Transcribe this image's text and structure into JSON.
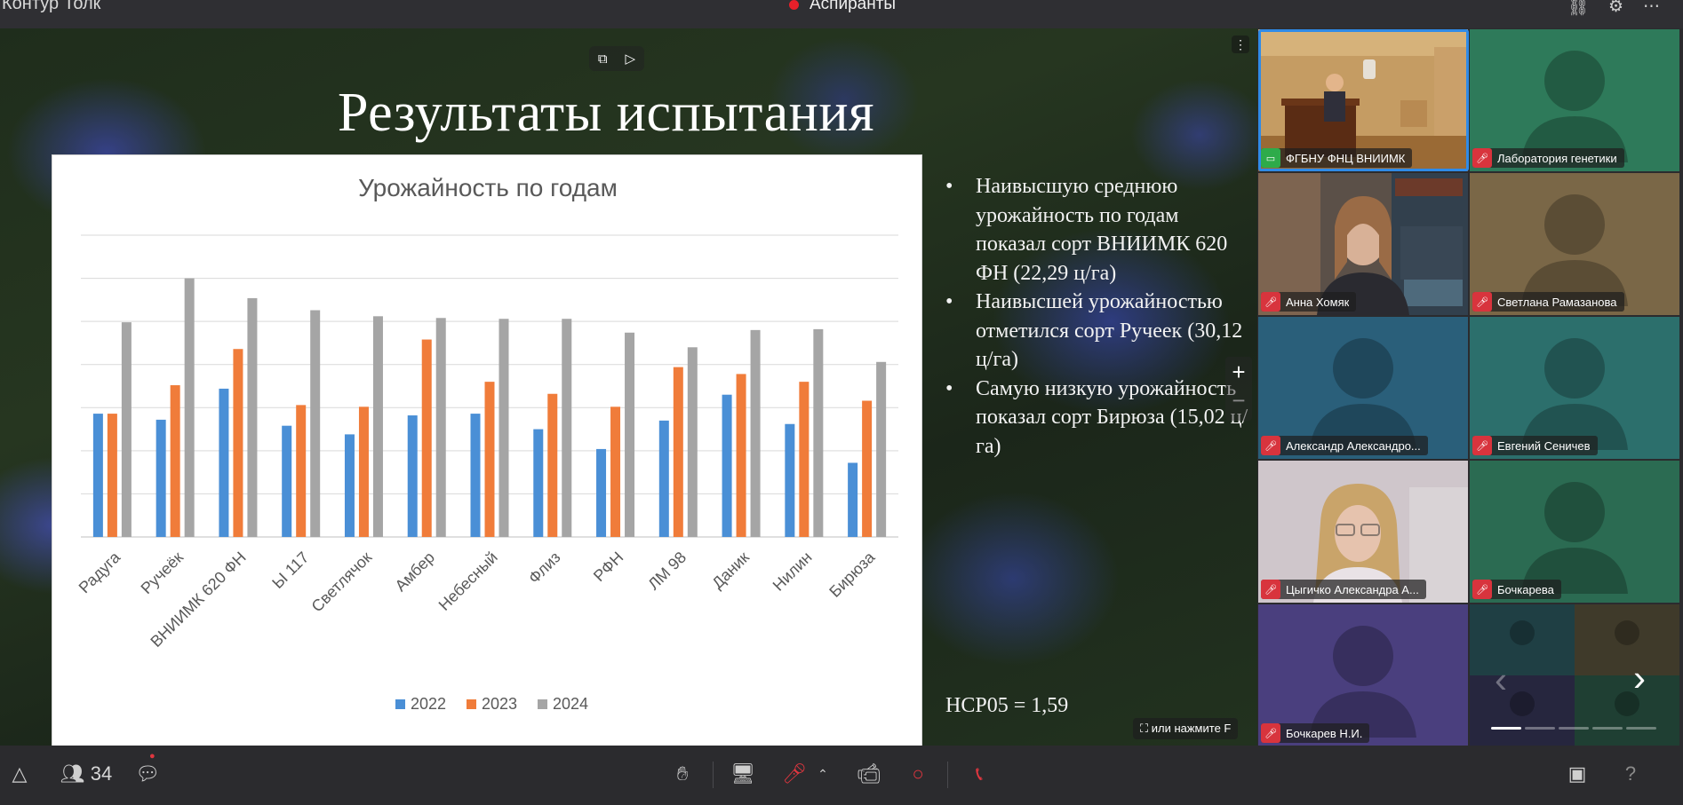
{
  "app_title": "Контур Толк",
  "meeting_title": "Аспиранты",
  "top_icons": [
    "link-icon",
    "settings-icon",
    "more-icon"
  ],
  "slide": {
    "title": "Результаты испытания",
    "bullets": [
      "Наивысшую среднюю урожайность по годам показал сорт ВНИИМК 620 ФН (22,29 ц/га)",
      "Наивысшей урожайностью отметился сорт Ручеек (30,12 ц/га)",
      "Самую низкую урожайность показал сорт Бирюза (15,02 ц/га)"
    ],
    "lsd": "НСР05 = 1,59"
  },
  "fullscreen_hint": "или нажмите F",
  "chart_data": {
    "type": "bar",
    "title": "Урожайность по годам",
    "categories": [
      "Радуга",
      "Ручеёк",
      "ВНИИМК 620 ФН",
      "Ы 117",
      "Светлячок",
      "Амбер",
      "Небесный",
      "Флиз",
      "РФН",
      "ЛМ 98",
      "Даник",
      "Нилин",
      "Бирюза"
    ],
    "series": [
      {
        "name": "2022",
        "color": "#4a8fd6",
        "values": [
          14.3,
          13.6,
          17.2,
          12.9,
          11.9,
          14.1,
          14.3,
          12.5,
          10.2,
          13.5,
          16.5,
          13.1,
          8.6
        ]
      },
      {
        "name": "2023",
        "color": "#f07c3a",
        "values": [
          14.3,
          17.6,
          21.8,
          15.3,
          15.1,
          22.9,
          18.0,
          16.6,
          15.1,
          19.7,
          18.9,
          18.0,
          15.8
        ]
      },
      {
        "name": "2024",
        "color": "#a5a5a5",
        "values": [
          24.9,
          30.0,
          27.7,
          26.3,
          25.6,
          25.4,
          25.3,
          25.3,
          23.7,
          22.0,
          24.0,
          24.1,
          20.3
        ]
      }
    ],
    "ylim": [
      0,
      35
    ],
    "grid": true,
    "legend": "bottom"
  },
  "participants": [
    {
      "name": "ФГБНУ ФНЦ ВНИИМК",
      "status": "screen-share-icon",
      "video": "lecture"
    },
    {
      "name": "Лаборатория генетики",
      "status": "mic-off-icon",
      "bg": "#2e7a5a"
    },
    {
      "name": "Анна Хомяк",
      "status": "mic-off-icon",
      "video": "anna"
    },
    {
      "name": "Светлана Рамазанова",
      "status": "mic-off-icon",
      "bg": "#7a6747"
    },
    {
      "name": "Александр Александро...",
      "status": "mic-off-icon",
      "bg": "#2a5f7a"
    },
    {
      "name": "Евгений Сеничев",
      "status": "mic-off-icon",
      "bg": "#2c6f6c"
    },
    {
      "name": "Цыгичко Александра А...",
      "status": "mic-off-icon",
      "video": "cyg"
    },
    {
      "name": "Бочкарева",
      "status": "mic-off-icon",
      "bg": "#2b6b52"
    },
    {
      "name": "Бочкарев Н.И.",
      "status": "mic-off-icon",
      "bg": "#4a3f7e"
    }
  ],
  "toolbar": {
    "participants_count": "34",
    "help": "?"
  },
  "colors": {
    "accent": "#2f8be8",
    "danger": "#e0363f",
    "toolbar_bg": "#2b2b2e"
  }
}
